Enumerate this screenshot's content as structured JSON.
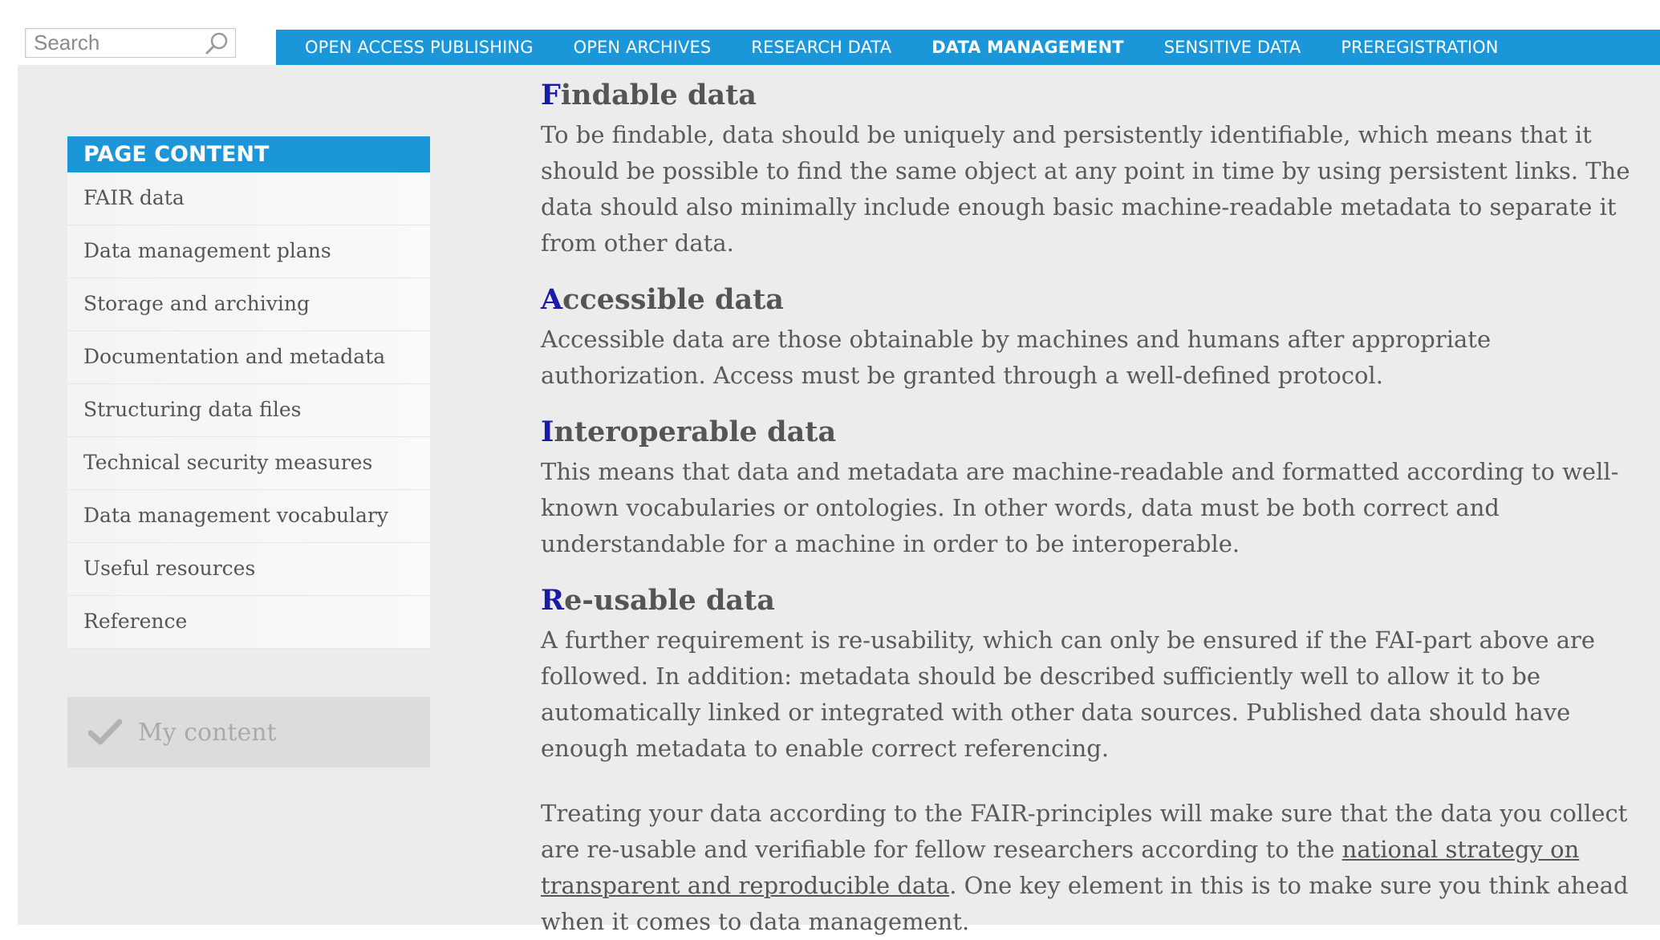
{
  "search": {
    "placeholder": "Search"
  },
  "topnav": [
    {
      "label": "OPEN ACCESS PUBLISHING",
      "active": false
    },
    {
      "label": "OPEN ARCHIVES",
      "active": false
    },
    {
      "label": "RESEARCH DATA",
      "active": false
    },
    {
      "label": "DATA MANAGEMENT",
      "active": true
    },
    {
      "label": "SENSITIVE DATA",
      "active": false
    },
    {
      "label": "PREREGISTRATION",
      "active": false
    }
  ],
  "sidebar": {
    "title": "PAGE CONTENT",
    "items": [
      "FAIR data",
      "Data management plans",
      "Storage and archiving",
      "Documentation and metadata",
      "Structuring data files",
      "Technical security measures",
      "Data management vocabulary",
      "Useful resources",
      "Reference"
    ],
    "my_content": "My content"
  },
  "article": {
    "sections": [
      {
        "initial": "F",
        "rest": "indable data",
        "body": "To be findable, data should be uniquely and persistently identifiable, which means that it  should be possible to find the same object at any point in time by  using persistent links. The data should also minimally include enough basic machine-readable metadata to separate it from other data."
      },
      {
        "initial": "A",
        "rest": "ccessible data",
        "body": "Accessible data are those obtainable by machines and humans after appropriate authorization. Access must be granted through a well-defined protocol."
      },
      {
        "initial": "I",
        "rest": "nteroperable data",
        "body": "This means that data and metadata are machine-readable and formatted according to well-known vocabularies or ontologies.  In other words, data must be both correct and understandable for a machine in order to be interoperable."
      },
      {
        "initial": "R",
        "rest": "e-usable data",
        "body": "A further requirement is re-usability, which can only be ensured if the FAI-part above are followed. In addition: metadata should be described sufficiently well to allow it to be automatically linked or integrated with other data sources.  Published data should have enough metadata to enable correct referencing."
      }
    ],
    "closing": {
      "before": "Treating your data according to the FAIR-principles will make sure that the data you collect are re-usable and verifiable for fellow researchers according to the ",
      "link": "national strategy on transparent and reproducible data",
      "after": ". One key element in this is to make sure you think ahead when it comes to data management."
    }
  },
  "colors": {
    "accent": "#1b96d8",
    "initial_letter": "#1a1aa6",
    "background": "#ececec"
  }
}
